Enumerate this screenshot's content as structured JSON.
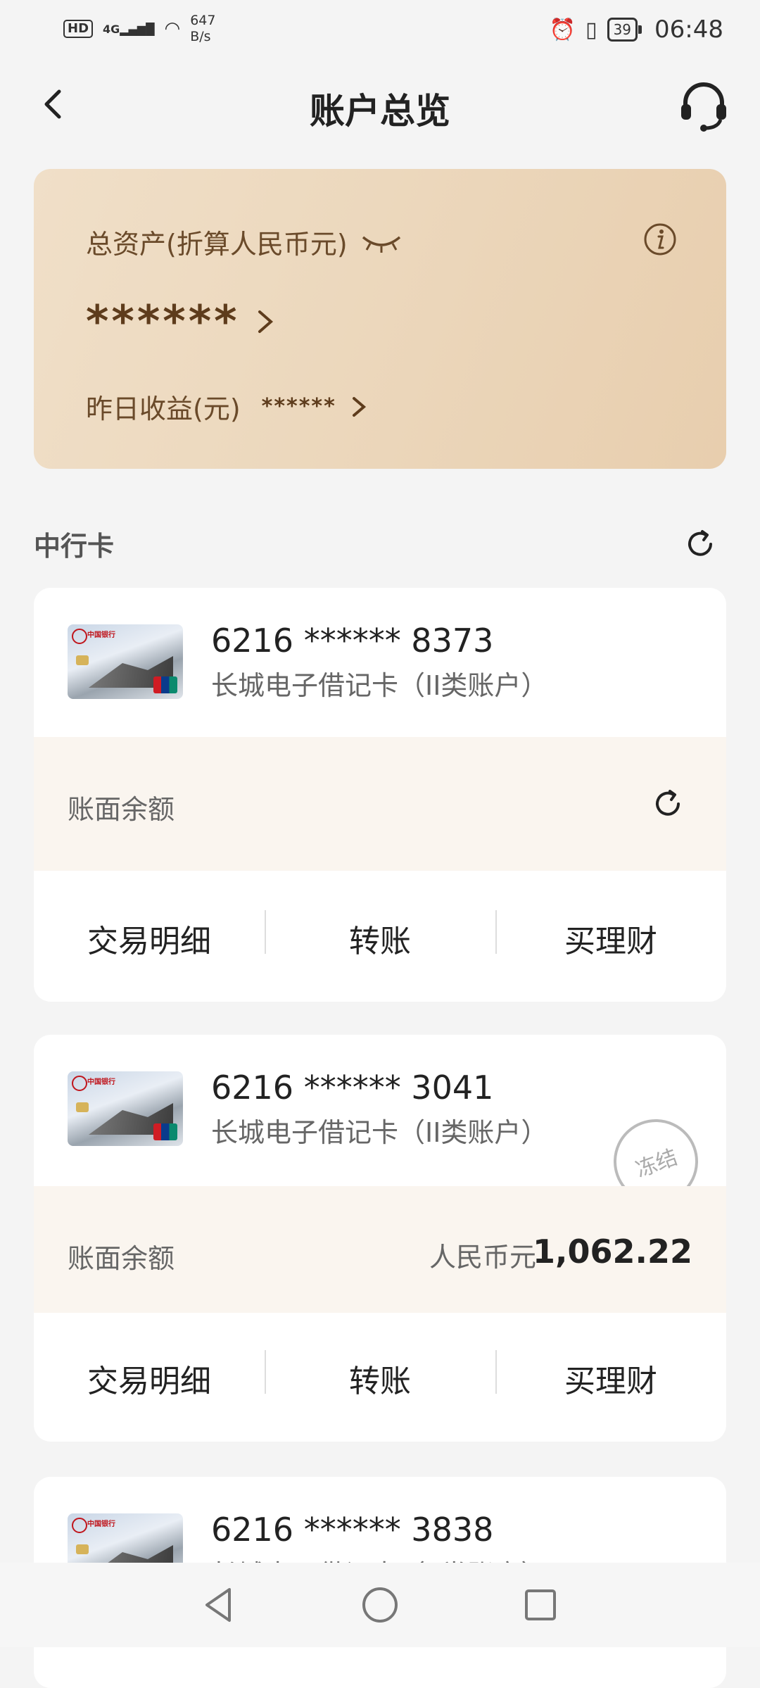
{
  "status_bar": {
    "hd": "HD",
    "network": "4G",
    "speed_value": "647",
    "speed_unit": "B/s",
    "battery": "39",
    "time": "06:48"
  },
  "header": {
    "title": "账户总览"
  },
  "asset_card": {
    "label": "总资产(折算人民币元)",
    "masked_value": "******",
    "yesterday_label": "昨日收益(元)",
    "yesterday_value": "******"
  },
  "section": {
    "title": "中行卡"
  },
  "cards": [
    {
      "number": "6216 ****** 8373",
      "type": "长城电子借记卡（II类账户）",
      "balance_label": "账面余额",
      "actions": [
        "交易明细",
        "转账",
        "买理财"
      ]
    },
    {
      "number": "6216 ****** 3041",
      "type": "长城电子借记卡（II类账户）",
      "stamp": "冻结",
      "balance_label": "账面余额",
      "currency": "人民币元",
      "amount": "1,062.22",
      "actions": [
        "交易明细",
        "转账",
        "买理财"
      ]
    },
    {
      "number": "6216 ****** 3838",
      "type": "长城电子借记卡（II类账户）"
    }
  ],
  "card_logo_text": "中国银行",
  "colors": {
    "asset_gradient_start": "#f0dfc8",
    "asset_gradient_end": "#e8ceae",
    "asset_text": "#6a4a2a",
    "balance_row_bg": "#faf5ef",
    "page_bg": "#f4f4f4"
  }
}
